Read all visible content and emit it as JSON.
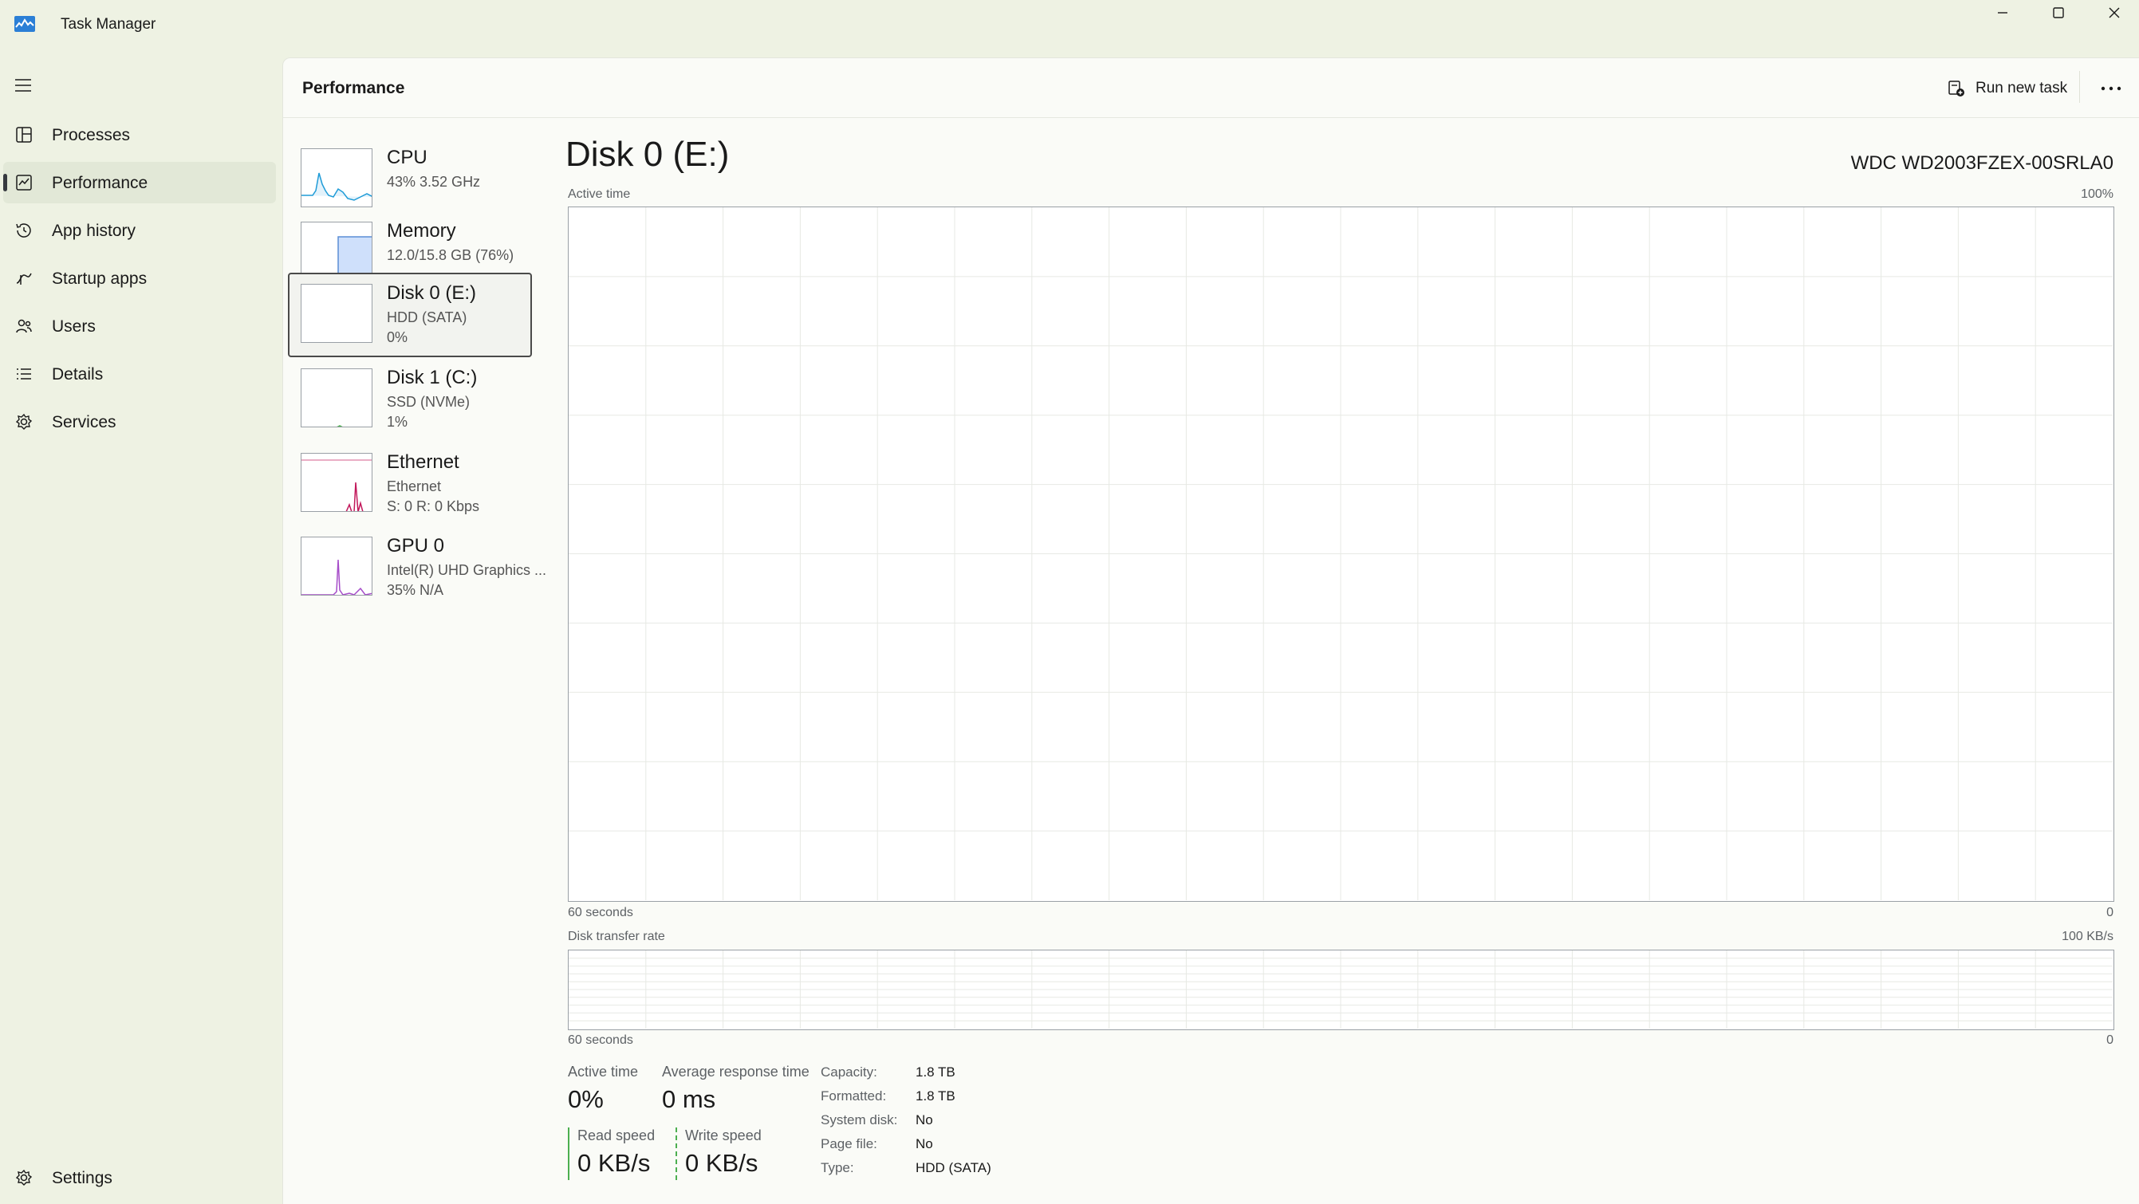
{
  "window": {
    "title": "Task Manager"
  },
  "sidebar": {
    "items": [
      {
        "label": "Processes",
        "icon": "processes-icon"
      },
      {
        "label": "Performance",
        "icon": "performance-icon",
        "active": true
      },
      {
        "label": "App history",
        "icon": "history-icon"
      },
      {
        "label": "Startup apps",
        "icon": "startup-icon"
      },
      {
        "label": "Users",
        "icon": "users-icon"
      },
      {
        "label": "Details",
        "icon": "details-icon"
      },
      {
        "label": "Services",
        "icon": "services-icon"
      }
    ],
    "settings_label": "Settings"
  },
  "header": {
    "title": "Performance",
    "run_new_task": "Run new task"
  },
  "devices": [
    {
      "name": "CPU",
      "line1": "43%  3.52 GHz",
      "line2": "",
      "color": "#1e9bd7"
    },
    {
      "name": "Memory",
      "line1": "12.0/15.8 GB (76%)",
      "line2": "",
      "color": "#5b8ed6"
    },
    {
      "name": "Disk 0 (E:)",
      "line1": "HDD (SATA)",
      "line2": "0%",
      "color": "#4caf50",
      "selected": true
    },
    {
      "name": "Disk 1 (C:)",
      "line1": "SSD (NVMe)",
      "line2": "1%",
      "color": "#4caf50"
    },
    {
      "name": "Ethernet",
      "line1": "Ethernet",
      "line2": "S: 0  R: 0 Kbps",
      "color": "#c2185b"
    },
    {
      "name": "GPU 0",
      "line1": "Intel(R) UHD Graphics ...",
      "line2": "35%  N/A",
      "color": "#a64dc9"
    }
  ],
  "detail": {
    "title": "Disk 0 (E:)",
    "model": "WDC WD2003FZEX-00SRLA0",
    "active_time_graph": {
      "label": "Active time",
      "max": "100%",
      "time_label": "60 seconds",
      "min": "0"
    },
    "transfer_graph": {
      "label": "Disk transfer rate",
      "max": "100 KB/s",
      "time_label": "60 seconds",
      "min": "0"
    },
    "stats": {
      "active_time_label": "Active time",
      "active_time_value": "0%",
      "avg_response_label": "Average response time",
      "avg_response_value": "0 ms",
      "read_speed_label": "Read speed",
      "read_speed_value": "0 KB/s",
      "write_speed_label": "Write speed",
      "write_speed_value": "0 KB/s"
    },
    "properties": [
      {
        "key": "Capacity:",
        "value": "1.8 TB"
      },
      {
        "key": "Formatted:",
        "value": "1.8 TB"
      },
      {
        "key": "System disk:",
        "value": "No"
      },
      {
        "key": "Page file:",
        "value": "No"
      },
      {
        "key": "Type:",
        "value": "HDD (SATA)"
      }
    ]
  },
  "colors": {
    "disk_accent": "#4caf50",
    "background": "#eef2e3",
    "panel": "#fafbf7"
  }
}
